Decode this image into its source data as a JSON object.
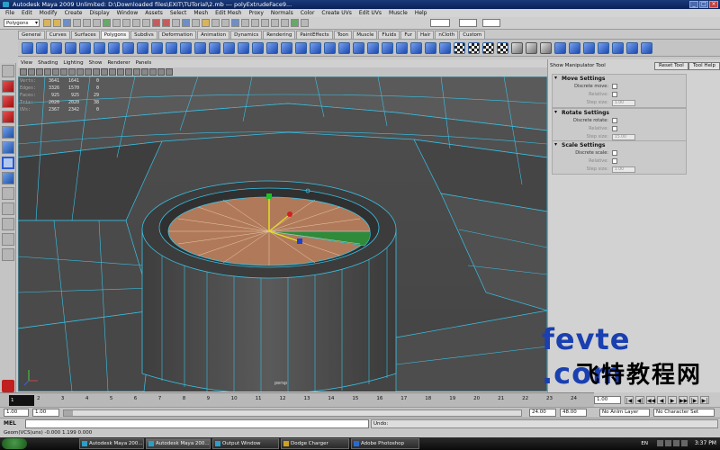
{
  "window": {
    "title": "Autodesk Maya 2009 Unlimited: D:\\Downloaded files\\EXIT\\TUTorial\\2.mb  ---  polyExtrudeFace9..."
  },
  "menus": [
    "File",
    "Edit",
    "Modify",
    "Create",
    "Display",
    "Window",
    "Assets",
    "Select",
    "Mesh",
    "Edit Mesh",
    "Proxy",
    "Normals",
    "Color",
    "Create UVs",
    "Edit UVs",
    "Muscle",
    "Help"
  ],
  "status_line": {
    "mode": "Polygons"
  },
  "shelf_tabs": [
    {
      "label": "General",
      "active": false
    },
    {
      "label": "Curves",
      "active": false
    },
    {
      "label": "Surfaces",
      "active": false
    },
    {
      "label": "Polygons",
      "active": true
    },
    {
      "label": "Subdivs",
      "active": false
    },
    {
      "label": "Deformation",
      "active": false
    },
    {
      "label": "Animation",
      "active": false
    },
    {
      "label": "Dynamics",
      "active": false
    },
    {
      "label": "Rendering",
      "active": false
    },
    {
      "label": "PaintEffects",
      "active": false
    },
    {
      "label": "Toon",
      "active": false
    },
    {
      "label": "Muscle",
      "active": false
    },
    {
      "label": "Fluids",
      "active": false
    },
    {
      "label": "Fur",
      "active": false
    },
    {
      "label": "Hair",
      "active": false
    },
    {
      "label": "nCloth",
      "active": false
    },
    {
      "label": "Custom",
      "active": false
    }
  ],
  "panel_menu": [
    "View",
    "Shading",
    "Lighting",
    "Show",
    "Renderer",
    "Panels"
  ],
  "hud": {
    "rows": [
      {
        "label": "Verts:",
        "a": "3641",
        "b": "1641",
        "c": "0"
      },
      {
        "label": "Edges:",
        "a": "3326",
        "b": "1570",
        "c": "0"
      },
      {
        "label": "Faces:",
        "a": "925",
        "b": "925",
        "c": "29"
      },
      {
        "label": "Tris:",
        "a": "2020",
        "b": "2020",
        "c": "38"
      },
      {
        "label": "UVs:",
        "a": "2367",
        "b": "2342",
        "c": "0"
      }
    ]
  },
  "camera_label": "persp",
  "attribute_editor": {
    "header": "Show Manipulator Tool",
    "reset_button": "Reset Tool",
    "help_button": "Tool Help",
    "sections": [
      {
        "title": "Move Settings",
        "rows": [
          {
            "label": "Discrete move:",
            "kind": "check",
            "dim": false
          },
          {
            "label": "Relative:",
            "kind": "check",
            "dim": true
          },
          {
            "label": "Step size:",
            "kind": "field",
            "value": "1.00",
            "dim": true
          }
        ]
      },
      {
        "title": "Rotate Settings",
        "rows": [
          {
            "label": "Discrete rotate:",
            "kind": "check",
            "dim": false
          },
          {
            "label": "Relative:",
            "kind": "check",
            "dim": true
          },
          {
            "label": "Step size:",
            "kind": "field",
            "value": "15.00",
            "dim": true
          }
        ]
      },
      {
        "title": "Scale Settings",
        "rows": [
          {
            "label": "Discrete scale:",
            "kind": "check",
            "dim": false
          },
          {
            "label": "Relative:",
            "kind": "check",
            "dim": true
          },
          {
            "label": "Step size:",
            "kind": "field",
            "value": "1.00",
            "dim": true
          }
        ]
      }
    ]
  },
  "time_slider": {
    "current_frame": "1",
    "ticks": [
      "1",
      "2",
      "3",
      "4",
      "5",
      "6",
      "7",
      "8",
      "9",
      "10",
      "11",
      "12",
      "13",
      "14",
      "15",
      "16",
      "17",
      "18",
      "19",
      "20",
      "21",
      "22",
      "23",
      "24"
    ],
    "current_time_field": "1.00"
  },
  "range_slider": {
    "start": "1.00",
    "start_inner": "1.00",
    "end_inner": "24.00",
    "end": "48.00",
    "anim_layer": "No Anim Layer",
    "character_set": "No Character Set"
  },
  "mel": {
    "label": "MEL",
    "result": "Undo:"
  },
  "help_line": "Geom(VCS)uns) -0.000        1.199        0.000",
  "taskbar": {
    "tasks": [
      {
        "label": "Autodesk Maya 200...",
        "kind": "maya",
        "active": false
      },
      {
        "label": "Autodesk Maya 200...",
        "kind": "maya",
        "active": true
      },
      {
        "label": "Output Window",
        "kind": "maya",
        "active": false
      },
      {
        "label": "Dodge Charger",
        "kind": "dc",
        "active": false
      },
      {
        "label": "Adobe Photoshop",
        "kind": "ps",
        "active": false
      }
    ],
    "lang": "EN",
    "clock": "3:37 PM"
  },
  "watermark": {
    "latin": "fevte .com",
    "chinese": "飞特教程网"
  },
  "colors": {
    "wire": "#39c2e6",
    "mesh": "#4a4a4a",
    "cap": "#b07a5a",
    "selected_face": "#2f8a3a",
    "watermark_blue": "#1a3fb0"
  }
}
